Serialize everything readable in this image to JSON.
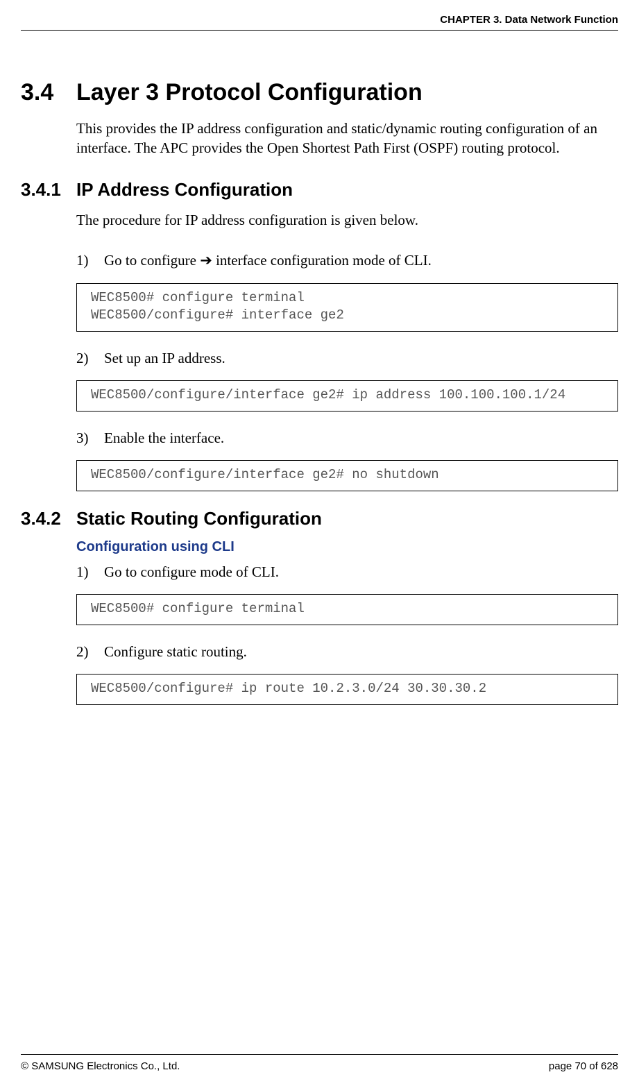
{
  "header": {
    "chapter": "CHAPTER 3. Data Network Function"
  },
  "section34": {
    "num": "3.4",
    "title": "Layer 3 Protocol Configuration",
    "desc": "This provides the IP address configuration and static/dynamic routing configuration of an interface. The APC provides the Open Shortest Path First (OSPF) routing protocol."
  },
  "section341": {
    "num": "3.4.1",
    "title": "IP Address Configuration",
    "desc": "The procedure for IP address configuration is given below.",
    "steps": [
      {
        "n": "1)",
        "pre": "Go to configure ",
        "arrow": "➔",
        "post": " interface configuration mode of CLI."
      },
      {
        "n": "2)",
        "text": "Set up an IP address."
      },
      {
        "n": "3)",
        "text": "Enable the interface."
      }
    ],
    "code1": "WEC8500# configure terminal\nWEC8500/configure# interface ge2",
    "code2": "WEC8500/configure/interface ge2# ip address 100.100.100.1/24",
    "code3": "WEC8500/configure/interface ge2# no shutdown"
  },
  "section342": {
    "num": "3.4.2",
    "title": "Static Routing Configuration",
    "sub": "Configuration using CLI",
    "steps": [
      {
        "n": "1)",
        "text": "Go to configure mode of CLI."
      },
      {
        "n": "2)",
        "text": "Configure static routing."
      }
    ],
    "code1": "WEC8500# configure terminal",
    "code2": "WEC8500/configure# ip route 10.2.3.0/24 30.30.30.2"
  },
  "footer": {
    "copyright": "© SAMSUNG Electronics Co., Ltd.",
    "page": "page 70 of 628"
  }
}
